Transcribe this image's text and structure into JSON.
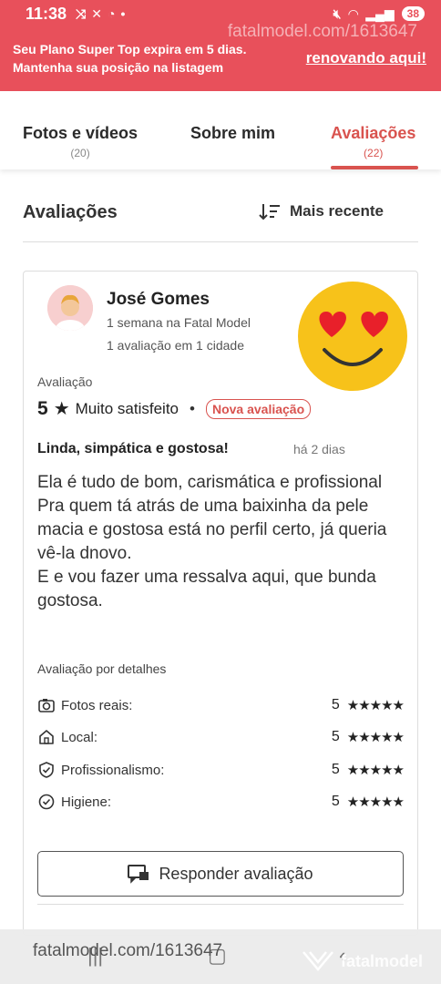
{
  "status_bar": {
    "time": "11:38",
    "battery": "38"
  },
  "promo": {
    "line1": "Seu Plano Super Top expira em 5 dias.",
    "line2": "Mantenha sua posição na listagem",
    "link": "renovando aqui!",
    "watermark": "fatalmodel.com/1613647"
  },
  "tabs": [
    {
      "label": "Fotos e vídeos",
      "count": "(20)"
    },
    {
      "label": "Sobre mim",
      "count": ""
    },
    {
      "label": "Avaliações",
      "count": "(22)"
    }
  ],
  "section": {
    "title": "Avaliações",
    "sort_label": "Mais recente"
  },
  "review": {
    "user_name": "José Gomes",
    "user_meta1": "1 semana na Fatal Model",
    "user_meta2": "1 avaliação em 1 cidade",
    "rating_label": "Avaliação",
    "rating_value": "5",
    "rating_text": "Muito satisfeito",
    "badge": "Nova avaliação",
    "title": "Linda, simpática e gostosa!",
    "time": "há 2 dias",
    "body": "Ela é tudo de bom, carismática e profissional\nPra quem tá atrás de uma baixinha da pele macia e gostosa está no perfil certo, já queria vê-la dnovo.\nE e vou fazer uma ressalva aqui, que bunda gostosa.",
    "details_label": "Avaliação por detalhes",
    "details": [
      {
        "label": "Fotos reais:",
        "score": "5",
        "stars": "★★★★★",
        "icon": "camera-check-icon"
      },
      {
        "label": "Local:",
        "score": "5",
        "stars": "★★★★★",
        "icon": "home-icon"
      },
      {
        "label": "Profissionalismo:",
        "score": "5",
        "stars": "★★★★★",
        "icon": "shield-check-icon"
      },
      {
        "label": "Higiene:",
        "score": "5",
        "stars": "★★★★★",
        "icon": "circle-check-icon"
      }
    ],
    "reply_label": "Responder avaliação"
  },
  "bottom": {
    "watermark": "fatalmodel.com/1613647",
    "logo_text": "fatalmodel"
  },
  "colors": {
    "brand_red": "#e8505b",
    "accent": "#d9534f"
  }
}
